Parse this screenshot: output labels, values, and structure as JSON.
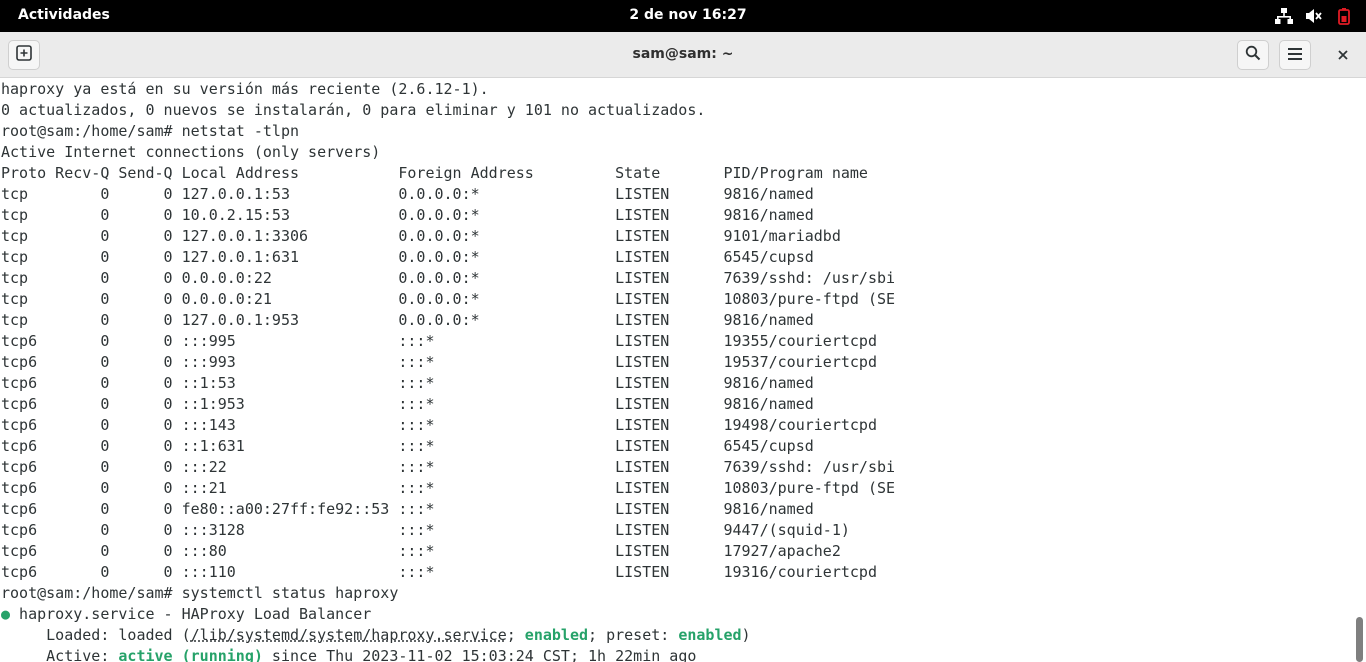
{
  "topbar": {
    "activities": "Actividades",
    "clock": "2 de nov  16:27",
    "tray_icons": [
      "network-wired-icon",
      "volume-muted-icon",
      "power-icon"
    ]
  },
  "window": {
    "title": "sam@sam: ~",
    "new_tab_icon": "new-tab-icon",
    "search_icon": "search-icon",
    "menu_icon": "hamburger-menu-icon",
    "close_icon": "close-icon"
  },
  "terminal": {
    "intro_lines": [
      "haproxy ya está en su versión más reciente (2.6.12-1).",
      "0 actualizados, 0 nuevos se instalarán, 0 para eliminar y 101 no actualizados.",
      "root@sam:/home/sam# netstat -tlpn",
      "Active Internet connections (only servers)"
    ],
    "netstat_header": "Proto Recv-Q Send-Q Local Address           Foreign Address         State       PID/Program name",
    "netstat_rows": [
      [
        "tcp",
        "0",
        "0",
        "127.0.0.1:53",
        "0.0.0.0:*",
        "LISTEN",
        "9816/named"
      ],
      [
        "tcp",
        "0",
        "0",
        "10.0.2.15:53",
        "0.0.0.0:*",
        "LISTEN",
        "9816/named"
      ],
      [
        "tcp",
        "0",
        "0",
        "127.0.0.1:3306",
        "0.0.0.0:*",
        "LISTEN",
        "9101/mariadbd"
      ],
      [
        "tcp",
        "0",
        "0",
        "127.0.0.1:631",
        "0.0.0.0:*",
        "LISTEN",
        "6545/cupsd"
      ],
      [
        "tcp",
        "0",
        "0",
        "0.0.0.0:22",
        "0.0.0.0:*",
        "LISTEN",
        "7639/sshd: /usr/sbi"
      ],
      [
        "tcp",
        "0",
        "0",
        "0.0.0.0:21",
        "0.0.0.0:*",
        "LISTEN",
        "10803/pure-ftpd (SE"
      ],
      [
        "tcp",
        "0",
        "0",
        "127.0.0.1:953",
        "0.0.0.0:*",
        "LISTEN",
        "9816/named"
      ],
      [
        "tcp6",
        "0",
        "0",
        ":::995",
        ":::*",
        "LISTEN",
        "19355/couriertcpd"
      ],
      [
        "tcp6",
        "0",
        "0",
        ":::993",
        ":::*",
        "LISTEN",
        "19537/couriertcpd"
      ],
      [
        "tcp6",
        "0",
        "0",
        "::1:53",
        ":::*",
        "LISTEN",
        "9816/named"
      ],
      [
        "tcp6",
        "0",
        "0",
        "::1:953",
        ":::*",
        "LISTEN",
        "9816/named"
      ],
      [
        "tcp6",
        "0",
        "0",
        ":::143",
        ":::*",
        "LISTEN",
        "19498/couriertcpd"
      ],
      [
        "tcp6",
        "0",
        "0",
        "::1:631",
        ":::*",
        "LISTEN",
        "6545/cupsd"
      ],
      [
        "tcp6",
        "0",
        "0",
        ":::22",
        ":::*",
        "LISTEN",
        "7639/sshd: /usr/sbi"
      ],
      [
        "tcp6",
        "0",
        "0",
        ":::21",
        ":::*",
        "LISTEN",
        "10803/pure-ftpd (SE"
      ],
      [
        "tcp6",
        "0",
        "0",
        "fe80::a00:27ff:fe92::53",
        ":::*",
        "LISTEN",
        "9816/named"
      ],
      [
        "tcp6",
        "0",
        "0",
        ":::3128",
        ":::*",
        "LISTEN",
        "9447/(squid-1)"
      ],
      [
        "tcp6",
        "0",
        "0",
        ":::80",
        ":::*",
        "LISTEN",
        "17927/apache2"
      ],
      [
        "tcp6",
        "0",
        "0",
        ":::110",
        ":::*",
        "LISTEN",
        "19316/couriertcpd"
      ]
    ],
    "prompt2": "root@sam:/home/sam# systemctl status haproxy",
    "status": {
      "bullet": "●",
      "unit_line": " haproxy.service - HAProxy Load Balancer",
      "loaded_prefix": "     Loaded: loaded (",
      "loaded_path": "/lib/systemd/system/haproxy.service",
      "loaded_sep": "; ",
      "enabled1": "enabled",
      "preset_label": "; preset: ",
      "enabled2": "enabled",
      "loaded_suffix": ")",
      "active_prefix": "     Active: ",
      "active_state": "active (running)",
      "active_suffix": " since Thu 2023-11-02 15:03:24 CST; 1h 22min ago"
    }
  }
}
